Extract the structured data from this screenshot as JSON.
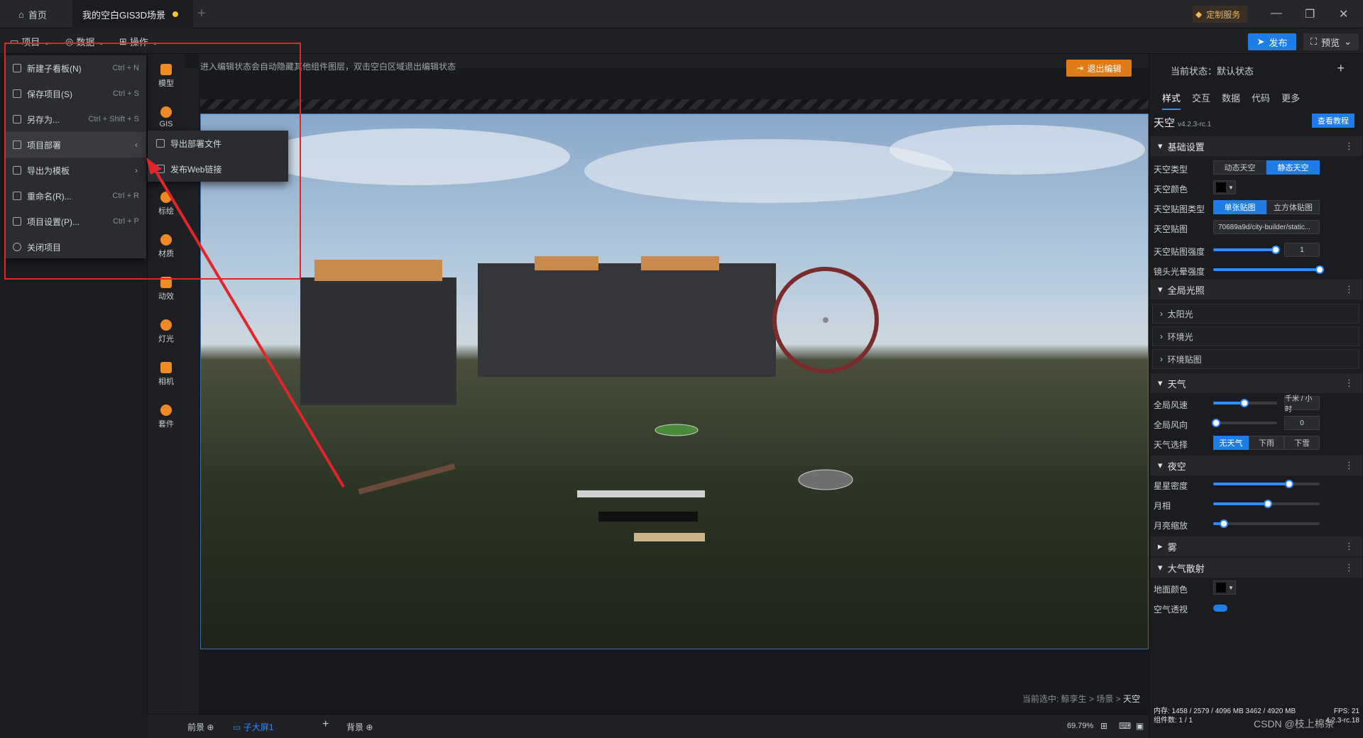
{
  "titlebar": {
    "home_tab": "首页",
    "project_tab": "我的空白GIS3D场景",
    "custom_service": "定制服务"
  },
  "menubar": {
    "project": "项目",
    "data": "数据",
    "operate": "操作",
    "publish": "发布",
    "preview": "预览"
  },
  "dropdown": [
    {
      "label": "新建子看板(N)",
      "shortcut": "Ctrl + N"
    },
    {
      "label": "保存项目(S)",
      "shortcut": "Ctrl + S"
    },
    {
      "label": "另存为...",
      "shortcut": "Ctrl + Shift + S"
    },
    {
      "label": "项目部署",
      "shortcut": ""
    },
    {
      "label": "导出为模板",
      "shortcut": ""
    },
    {
      "label": "重命名(R)...",
      "shortcut": "Ctrl + R"
    },
    {
      "label": "项目设置(P)...",
      "shortcut": "Ctrl + P"
    },
    {
      "label": "关闭项目",
      "shortcut": ""
    }
  ],
  "submenu": [
    {
      "label": "导出部署文件"
    },
    {
      "label": "发布Web链接"
    }
  ],
  "tools": [
    "模型",
    "GIS",
    "标绘",
    "材质",
    "动效",
    "灯光",
    "相机",
    "套件"
  ],
  "canvas": {
    "hint": "进入编辑状态会自动隐藏其他组件图层，双击空白区域退出编辑状态",
    "exit_edit": "退出编辑",
    "path_prefix": "当前选中: 鲸孪生 > 场景 > ",
    "path_last": "天空"
  },
  "bottombar": {
    "front": "前景",
    "sub_screen": "子大屏1",
    "background": "背景",
    "zoom": "69.79%"
  },
  "rightpanel": {
    "state": "当前状态：默认状态",
    "tabs": [
      "样式",
      "交互",
      "数据",
      "代码",
      "更多"
    ],
    "component": "天空",
    "version": "v4.2.3-rc.1",
    "tutorial": "查看教程",
    "sections": {
      "basic": "基础设置",
      "global_light": "全局光照",
      "weather": "天气",
      "night": "夜空",
      "fog": "雾",
      "atmosphere": "大气散射"
    },
    "rows": {
      "sky_type": "天空类型",
      "sky_type_opts": [
        "动态天空",
        "静态天空"
      ],
      "sky_color": "天空颜色",
      "sky_tex_type": "天空贴图类型",
      "sky_tex_opts": [
        "单张贴图",
        "立方体贴图"
      ],
      "sky_tex": "天空贴图",
      "sky_tex_value": "70689a9d/city-builder/static...",
      "sky_tex_strength": "天空贴图强度",
      "sky_tex_strength_value": "1",
      "lens_flare": "镜头光晕强度",
      "sun": "太阳光",
      "ambient": "环境光",
      "env_map": "环境贴图",
      "wind_speed": "全局风速",
      "wind_speed_unit": "千米 / 小时",
      "wind_dir": "全局风向",
      "wind_dir_value": "0",
      "weather_select": "天气选择",
      "weather_opts": [
        "无天气",
        "下雨",
        "下雪"
      ],
      "star_density": "星星密度",
      "moon_phase": "月相",
      "moon_scale": "月亮缩放",
      "ground_color": "地面颜色",
      "air_persp": "空气透视"
    },
    "stats": {
      "memory": "内存: 1458 / 2579 / 4096 MB  3462 / 4920 MB",
      "fps": "FPS: 21",
      "components": "组件数: 1 / 1",
      "ver": "4.2.3-rc.18"
    }
  },
  "watermark": "CSDN @枝上棉条",
  "colors": {
    "accent": "#1e7de6",
    "annotation": "#e0262a",
    "exit_button": "#e07b1a"
  }
}
